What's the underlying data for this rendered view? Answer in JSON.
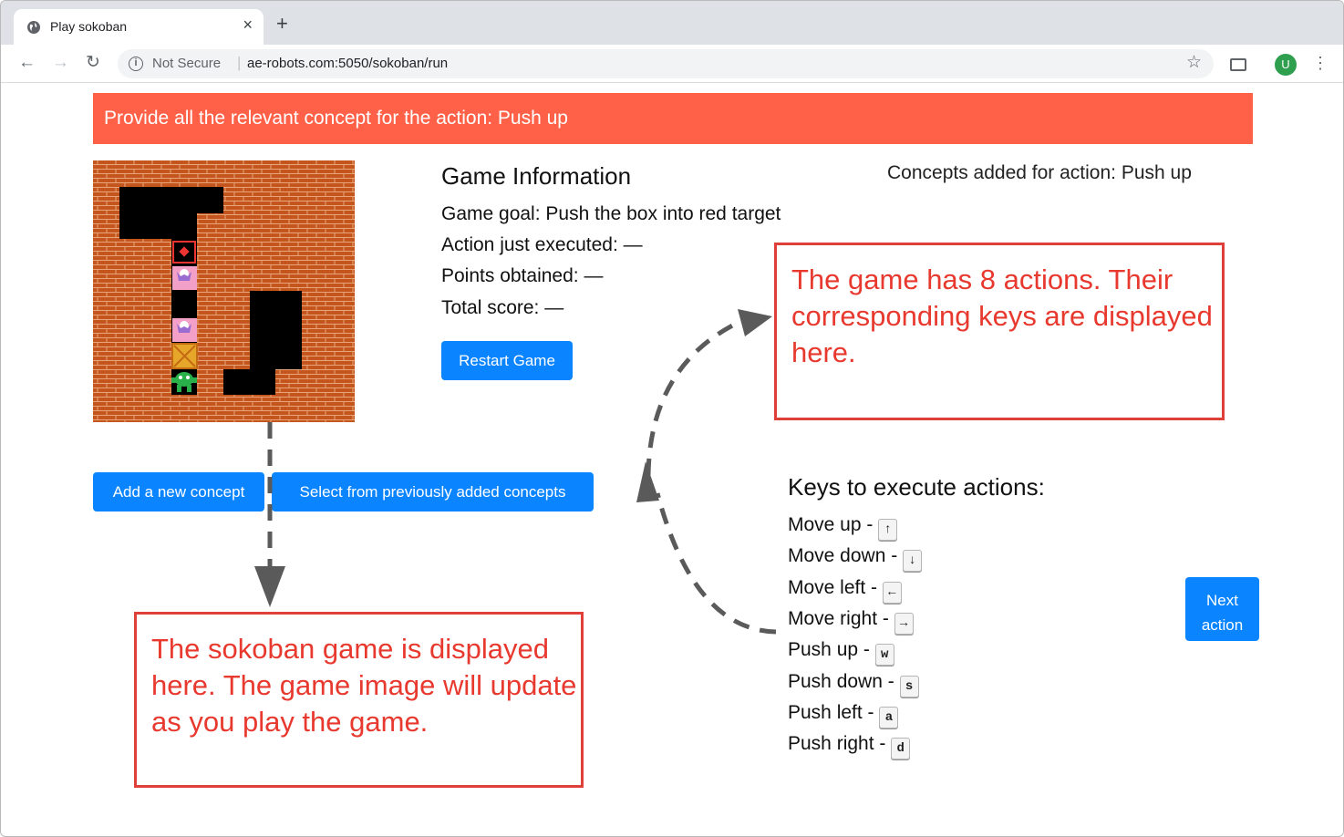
{
  "browser": {
    "tab_title": "Play sokoban",
    "not_secure": "Not Secure",
    "url": "ae-robots.com:5050/sokoban/run",
    "profile_initial": "U"
  },
  "banner": {
    "text": "Provide all the relevant concept for the action: Push up",
    "color": "#ff6148"
  },
  "game_info": {
    "heading": "Game Information",
    "goal": "Game goal: Push the box into red target",
    "action_executed": "Action just executed: —",
    "points": "Points obtained: —",
    "total_score": "Total score: —"
  },
  "concepts_title": "Concepts added for action: Push up",
  "buttons": {
    "restart": "Restart Game",
    "add_concept": "Add a new concept",
    "select_concepts": "Select from previously added concepts",
    "next_line1": "Next",
    "next_line2": "action"
  },
  "keys": {
    "title": "Keys to execute actions:",
    "items": [
      {
        "label": "Move up -",
        "key": "↑"
      },
      {
        "label": "Move down -",
        "key": "↓"
      },
      {
        "label": "Move left -",
        "key": "←"
      },
      {
        "label": "Move right -",
        "key": "→"
      },
      {
        "label": "Push up -",
        "key": "w"
      },
      {
        "label": "Push down -",
        "key": "s"
      },
      {
        "label": "Push left -",
        "key": "a"
      },
      {
        "label": "Push right -",
        "key": "d"
      }
    ]
  },
  "annotations": {
    "keys_note": "The game has 8 actions. Their corresponding keys are displayed here.",
    "game_note": "The sokoban game is displayed here. The game image will update as you play the game."
  },
  "colors": {
    "button": "#0b84ff",
    "annotation": "#e8392f",
    "brick": "#c4561d"
  }
}
